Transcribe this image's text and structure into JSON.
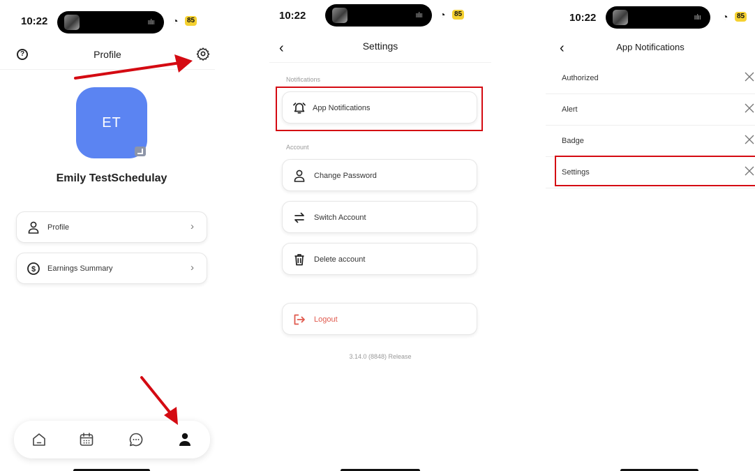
{
  "status_bar": {
    "time": "10:22",
    "wifi_glyph": "wifi-icon",
    "battery": "85",
    "wave_glyph": "waveform-icon"
  },
  "screen1": {
    "title": "Profile",
    "avatar_initials": "ET",
    "user_name": "Emily TestSchedulay",
    "items": [
      {
        "label": "Profile",
        "icon": "user-icon"
      },
      {
        "label": "Earnings Summary",
        "icon": "dollar-icon"
      }
    ],
    "tabs": [
      "home-icon",
      "calendar-icon",
      "chat-icon",
      "person-icon"
    ],
    "arrow_color": "#d40a12"
  },
  "screen2": {
    "title": "Settings",
    "sections": {
      "notifications": "Notifications",
      "account": "Account"
    },
    "items": {
      "app_notifications": "App Notifications",
      "change_password": "Change Password",
      "switch_account": "Switch Account",
      "delete_account": "Delete account",
      "logout": "Logout"
    },
    "version": "3.14.0 (8848) Release",
    "logout_color": "#e05a4e",
    "highlight_color": "#d40a12"
  },
  "screen3": {
    "title": "App Notifications",
    "rows": [
      {
        "label": "Authorized"
      },
      {
        "label": "Alert"
      },
      {
        "label": "Badge"
      },
      {
        "label": "Settings"
      }
    ]
  }
}
